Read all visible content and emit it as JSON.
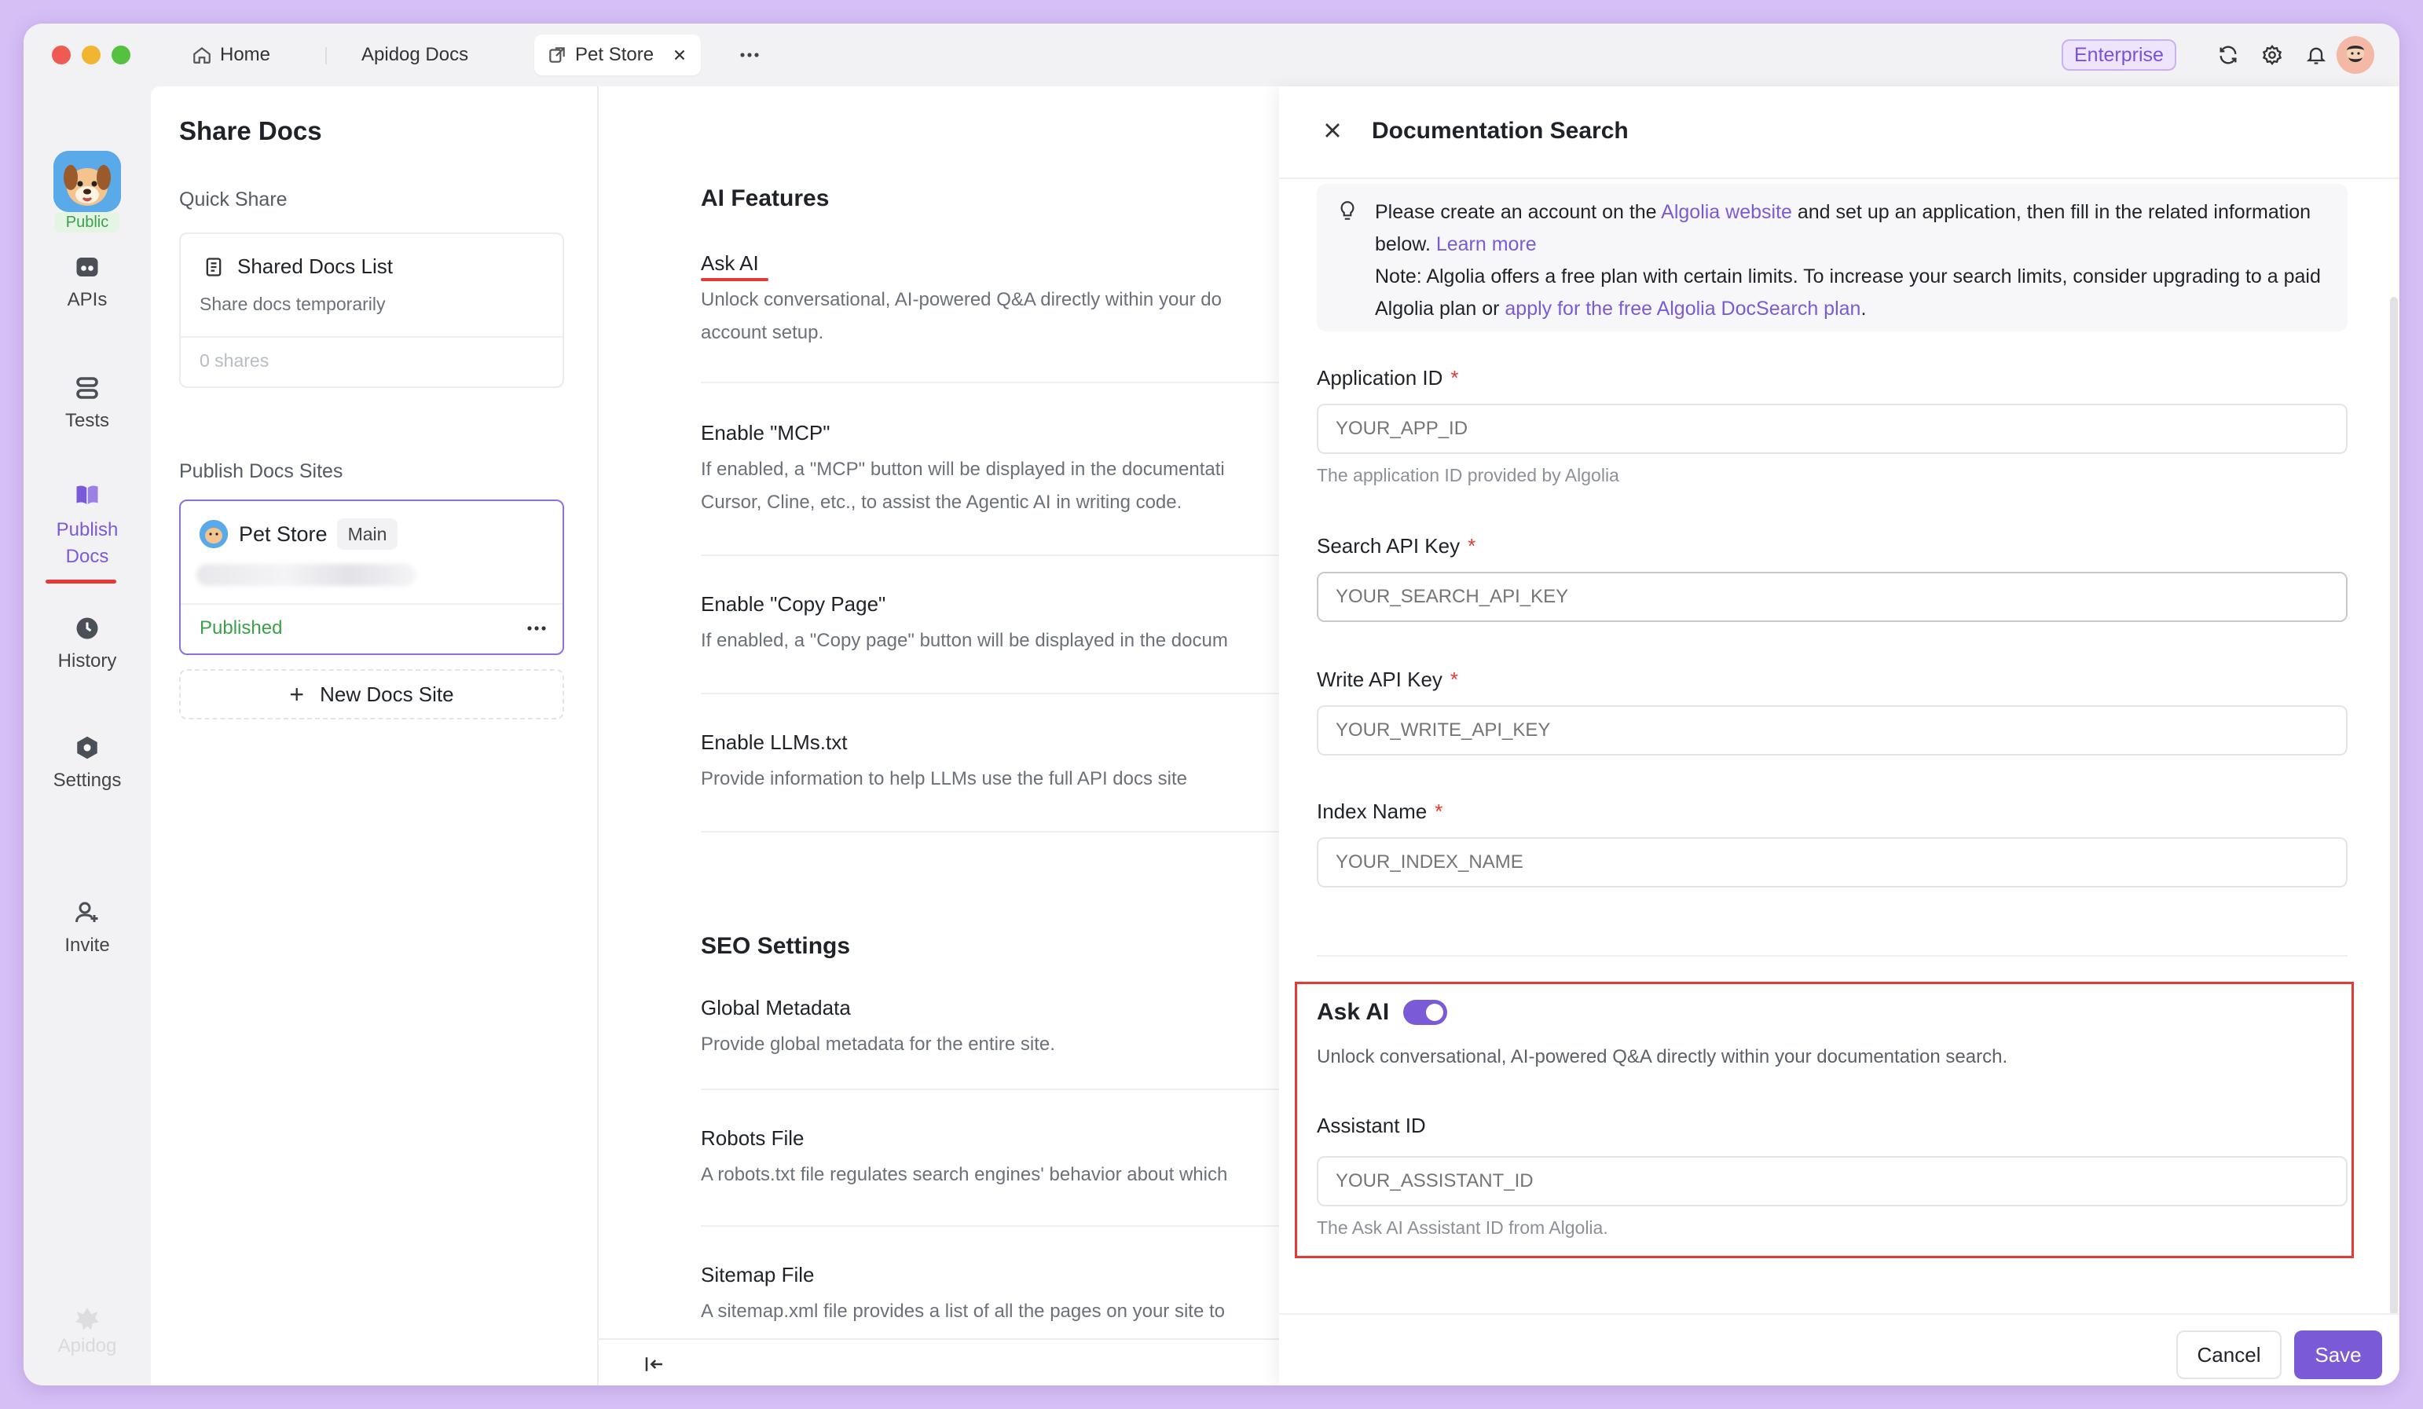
{
  "titlebar": {
    "tabs": [
      {
        "label": "Home",
        "icon": "home-icon"
      },
      {
        "label": "Apidog Docs",
        "icon": ""
      },
      {
        "label": "Pet Store",
        "icon": "external-link-icon",
        "active": true
      }
    ],
    "more_label": "···",
    "plan_badge": "Enterprise",
    "icons": [
      "refresh-icon",
      "gear-icon",
      "bell-icon",
      "user-avatar"
    ]
  },
  "nav": {
    "visibility_badge": "Public",
    "items": [
      {
        "label": "APIs",
        "icon": "api-icon"
      },
      {
        "label": "Tests",
        "icon": "tests-icon"
      },
      {
        "label": "Publish Docs",
        "icon": "book-icon",
        "active": true
      },
      {
        "label": "History",
        "icon": "clock-icon"
      },
      {
        "label": "Settings",
        "icon": "settings-hexagon-icon"
      },
      {
        "label": "Invite",
        "icon": "add-user-icon"
      }
    ],
    "brand": "Apidog"
  },
  "share": {
    "title": "Share Docs",
    "quick_share_label": "Quick Share",
    "shared_list": {
      "title": "Shared Docs List",
      "subtitle": "Share docs temporarily",
      "count": "0 shares"
    },
    "publish_label": "Publish Docs Sites",
    "site": {
      "name": "Pet Store",
      "branch": "Main",
      "status": "Published"
    },
    "new_site_label": "New Docs Site"
  },
  "settings": {
    "ai_heading": "AI Features",
    "ai_items": [
      {
        "title": "Ask AI",
        "desc": "Unlock conversational, AI-powered Q&A directly within your do",
        "desc2": "account setup."
      },
      {
        "title": "Enable \"MCP\"",
        "desc": "If enabled, a \"MCP\" button will be displayed in the documentati",
        "desc2": "Cursor, Cline, etc., to assist the Agentic AI in writing code."
      },
      {
        "title": "Enable \"Copy Page\"",
        "desc": "If enabled, a \"Copy page\" button will be displayed in the docum",
        "desc2": ""
      },
      {
        "title": "Enable LLMs.txt",
        "desc": "Provide information to help LLMs use the full API docs site",
        "desc2": ""
      }
    ],
    "seo_heading": "SEO Settings",
    "seo_items": [
      {
        "title": "Global Metadata",
        "desc": "Provide global metadata for the entire site."
      },
      {
        "title": "Robots File",
        "desc": "A robots.txt file regulates search engines' behavior about which"
      },
      {
        "title": "Sitemap File",
        "desc": "A sitemap.xml file provides a list of all the pages on your site to"
      }
    ]
  },
  "drawer": {
    "title": "Documentation Search",
    "notice": {
      "p1_a": "Please create an account on the ",
      "p1_link": "Algolia website",
      "p1_b": " and set up an application, then fill in the related information below. ",
      "p1_learn": "Learn more",
      "p2_a": "Note: Algolia offers a free plan with certain limits. To increase your search limits, consider upgrading to a paid Algolia plan or ",
      "p2_link": "apply for the free Algolia DocSearch plan",
      "p2_b": "."
    },
    "fields": {
      "app_id": {
        "label": "Application ID",
        "placeholder": "YOUR_APP_ID",
        "help": "The application ID provided by Algolia"
      },
      "search_key": {
        "label": "Search API Key",
        "placeholder": "YOUR_SEARCH_API_KEY"
      },
      "write_key": {
        "label": "Write API Key",
        "placeholder": "YOUR_WRITE_API_KEY"
      },
      "index_name": {
        "label": "Index Name",
        "placeholder": "YOUR_INDEX_NAME"
      },
      "assistant_id": {
        "label": "Assistant ID",
        "placeholder": "YOUR_ASSISTANT_ID",
        "help": "The Ask AI Assistant ID from Algolia."
      }
    },
    "required_mark": "*",
    "ask_ai": {
      "label": "Ask AI",
      "enabled": true,
      "desc": "Unlock conversational, AI-powered Q&A directly within your documentation search."
    },
    "cancel_label": "Cancel",
    "save_label": "Save"
  },
  "colors": {
    "accent": "#7b5ad8",
    "highlight": "#e53935",
    "success": "#3aa14a"
  }
}
